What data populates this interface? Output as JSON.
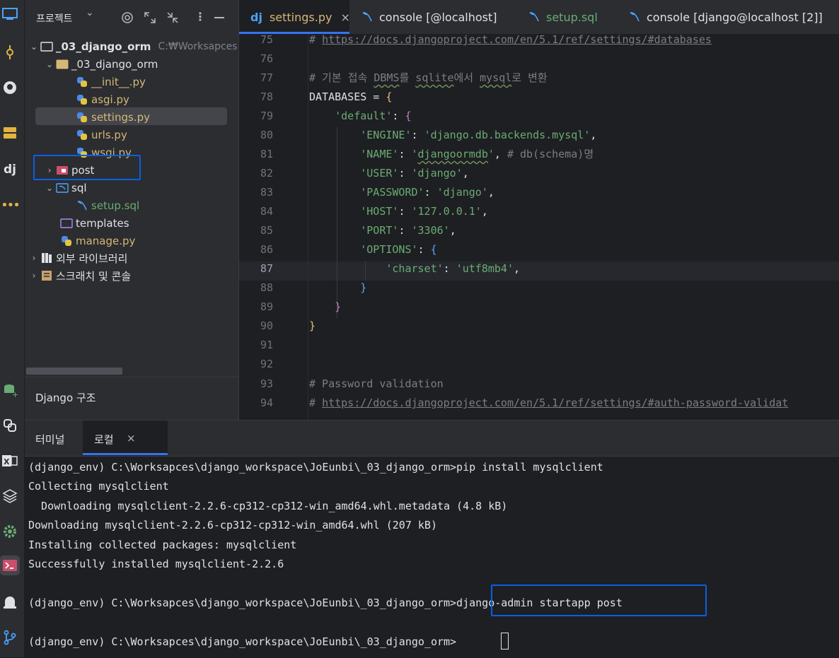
{
  "project_panel": {
    "title": "프로젝트",
    "dropdown_glyph": "⌄",
    "root": {
      "name": "_03_django_orm",
      "path": "C:₩Worksapces"
    },
    "items": [
      {
        "name": "_03_django_orm",
        "kind": "folder"
      },
      {
        "name": "__init__.py",
        "kind": "py"
      },
      {
        "name": "asgi.py",
        "kind": "py"
      },
      {
        "name": "settings.py",
        "kind": "py"
      },
      {
        "name": "urls.py",
        "kind": "py"
      },
      {
        "name": "wsgi.py",
        "kind": "py"
      },
      {
        "name": "post",
        "kind": "package"
      },
      {
        "name": "sql",
        "kind": "folder-sql"
      },
      {
        "name": "setup.sql",
        "kind": "sql"
      },
      {
        "name": "templates",
        "kind": "folder"
      },
      {
        "name": "manage.py",
        "kind": "py"
      },
      {
        "name": "외부 라이브러리",
        "kind": "library"
      },
      {
        "name": "스크래치 및 콘솔",
        "kind": "scratch"
      }
    ],
    "django_structure_title": "Django 구조"
  },
  "tabs": [
    {
      "label": "settings.py",
      "icon": "django-icon",
      "active": true,
      "close": "×"
    },
    {
      "label": "console [@localhost]",
      "icon": "console-icon"
    },
    {
      "label": "setup.sql",
      "icon": "sql-icon"
    },
    {
      "label": "console [django@localhost [2]]",
      "icon": "console-icon"
    }
  ],
  "code": {
    "lines": [
      {
        "n": "75",
        "t": "# https://docs.djangoproject.com/en/5.1/ref/settings/#databases"
      },
      {
        "n": "76",
        "t": ""
      },
      {
        "n": "77",
        "t": "# 기본 접속 DBMS를 sqlite에서 mysql로 변환"
      },
      {
        "n": "78",
        "t": "DATABASES = {"
      },
      {
        "n": "79",
        "t": "    'default': {"
      },
      {
        "n": "80",
        "t": "        'ENGINE': 'django.db.backends.mysql',"
      },
      {
        "n": "81",
        "t": "        'NAME': 'djangoormdb', # db(schema)명"
      },
      {
        "n": "82",
        "t": "        'USER': 'django',"
      },
      {
        "n": "83",
        "t": "        'PASSWORD': 'django',"
      },
      {
        "n": "84",
        "t": "        'HOST': '127.0.0.1',"
      },
      {
        "n": "85",
        "t": "        'PORT': '3306',"
      },
      {
        "n": "86",
        "t": "        'OPTIONS': {"
      },
      {
        "n": "87",
        "t": "            'charset': 'utf8mb4',"
      },
      {
        "n": "88",
        "t": "        }"
      },
      {
        "n": "89",
        "t": "    }"
      },
      {
        "n": "90",
        "t": "}"
      },
      {
        "n": "91",
        "t": ""
      },
      {
        "n": "92",
        "t": ""
      },
      {
        "n": "93",
        "t": "# Password validation"
      },
      {
        "n": "94",
        "t": "# https://docs.djangoproject.com/en/5.1/ref/settings/#auth-password-validat"
      }
    ]
  },
  "terminal": {
    "tabs": [
      {
        "label": "터미널"
      },
      {
        "label": "로컬",
        "active": true,
        "close": "×"
      }
    ],
    "lines": [
      "(django_env) C:\\Worksapces\\django_workspace\\JoEunbi\\_03_django_orm>pip install mysqlclient",
      "Collecting mysqlclient",
      "  Downloading mysqlclient-2.2.6-cp312-cp312-win_amd64.whl.metadata (4.8 kB)",
      "Downloading mysqlclient-2.2.6-cp312-cp312-win_amd64.whl (207 kB)",
      "Installing collected packages: mysqlclient",
      "Successfully installed mysqlclient-2.2.6",
      "",
      "(django_env) C:\\Worksapces\\django_workspace\\JoEunbi\\_03_django_orm>django-admin startapp post",
      "",
      "(django_env) C:\\Worksapces\\django_workspace\\JoEunbi\\_03_django_orm>"
    ]
  },
  "colors": {
    "accent_highlight": "#0a5fe6",
    "bg_panel": "#2b2d30",
    "bg_editor": "#1e1f22",
    "string": "#6aab73",
    "comment": "#7a7e85"
  }
}
